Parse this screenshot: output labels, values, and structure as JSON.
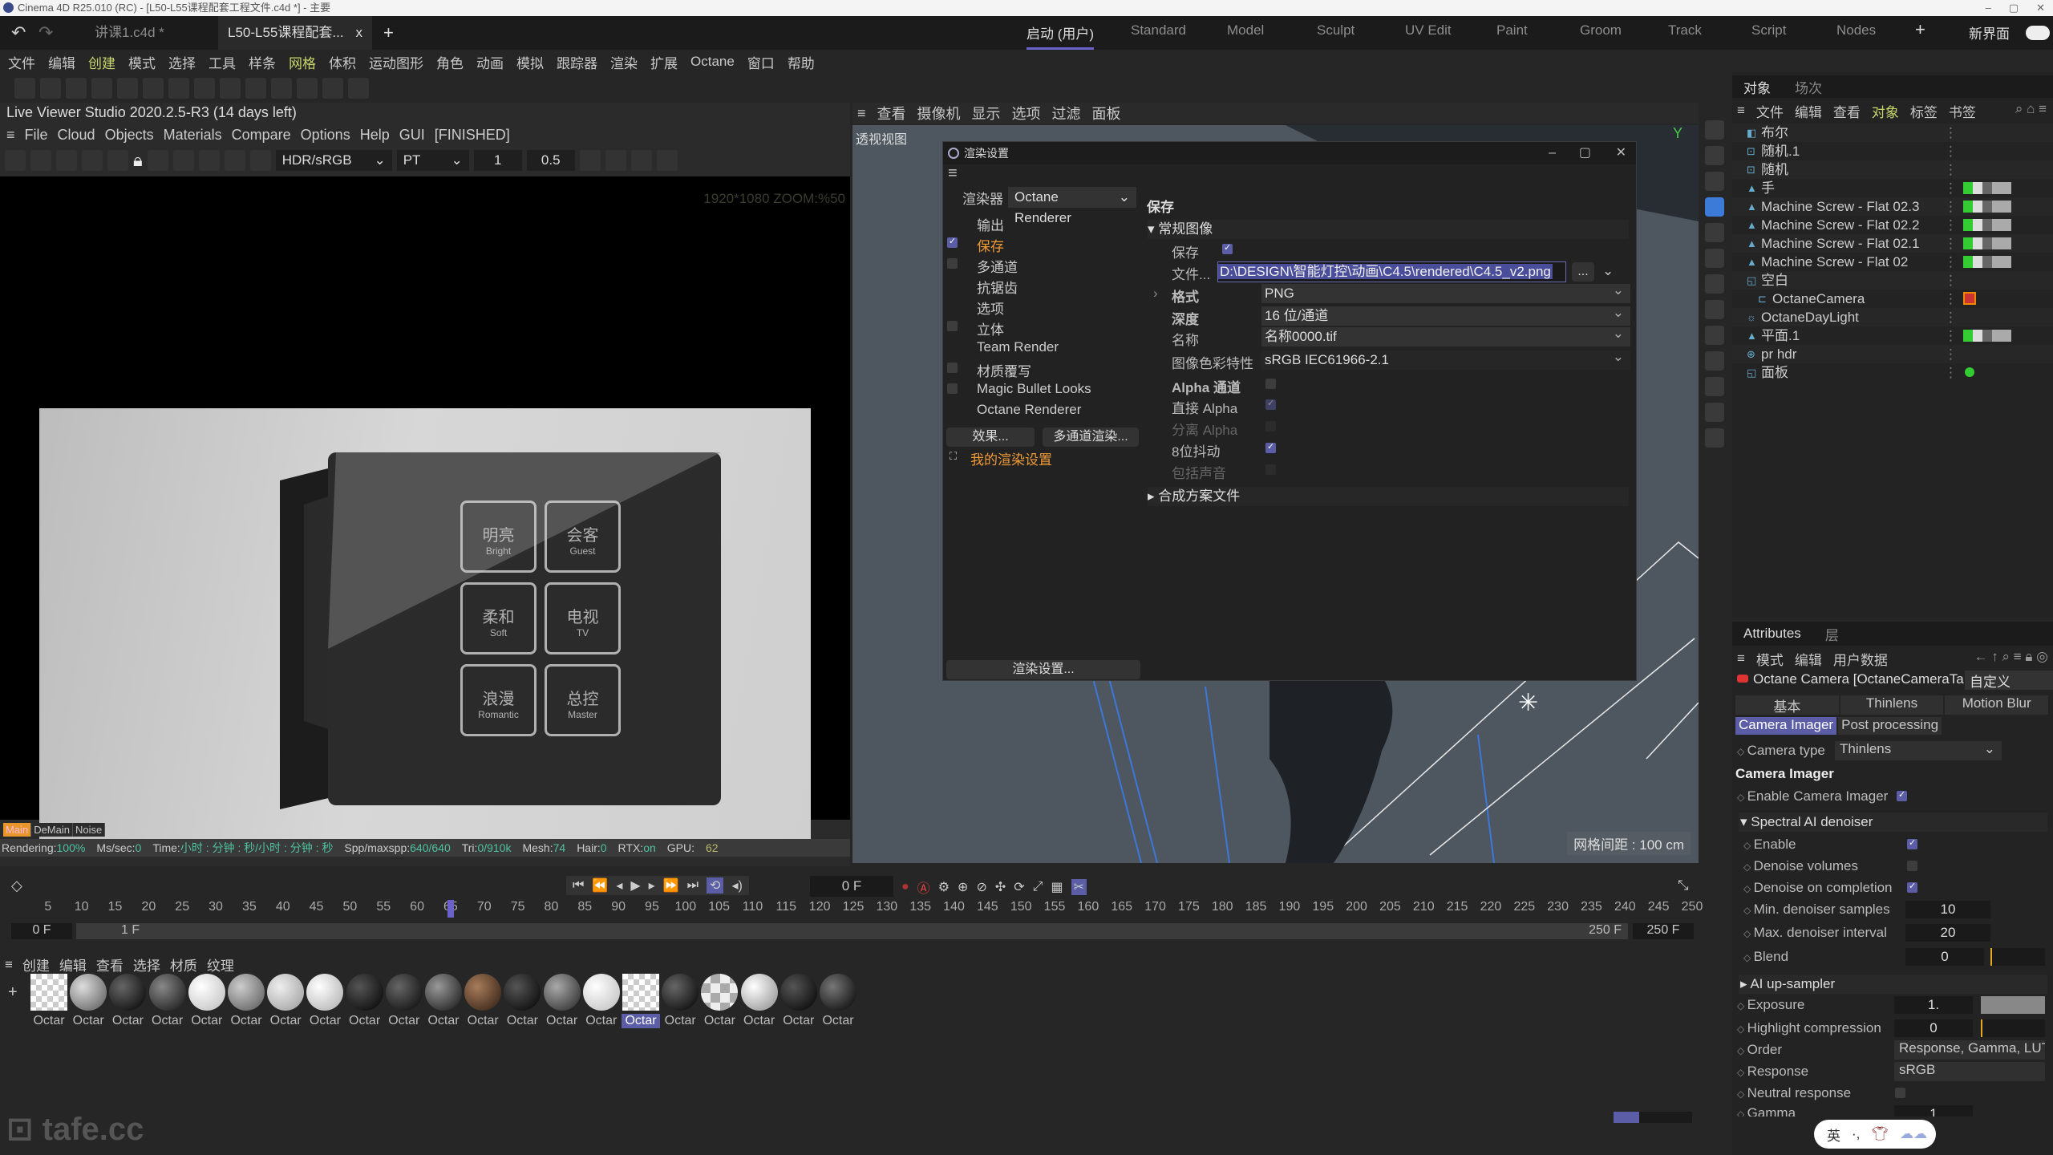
{
  "window": {
    "title": "Cinema 4D R25.010 (RC) - [L50-L55课程配套工程文件.c4d *] - 主要",
    "controls": [
      "–",
      "▢",
      "✕"
    ]
  },
  "file_tabs": [
    {
      "label": "讲课1.c4d *"
    },
    {
      "label": "L50-L55课程配套...",
      "close": "x"
    }
  ],
  "new_tab": "+",
  "layouts": [
    "启动 (用户)",
    "Standard",
    "Model",
    "Sculpt",
    "UV Edit",
    "Paint",
    "Groom",
    "Track",
    "Script",
    "Nodes"
  ],
  "layout_add": "+",
  "new_ui": "新界面",
  "menu": [
    "文件",
    "编辑",
    "创建",
    "模式",
    "选择",
    "工具",
    "样条",
    "网格",
    "体积",
    "运动图形",
    "角色",
    "动画",
    "模拟",
    "跟踪器",
    "渲染",
    "扩展",
    "Octane",
    "窗口",
    "帮助"
  ],
  "live_viewer": {
    "title": "Live Viewer Studio 2020.2.5-R3 (14 days left)",
    "menu": [
      "File",
      "Cloud",
      "Objects",
      "Materials",
      "Compare",
      "Options",
      "Help",
      "GUI",
      "[FINISHED]"
    ],
    "color_mode": "HDR/sRGB",
    "kernel": "PT",
    "value1": "1",
    "value2": "0.5",
    "zoom_label": "1920*1080 ZOOM:%50",
    "render_buttons": [
      {
        "cn": "明亮",
        "en": "Bright"
      },
      {
        "cn": "会客",
        "en": "Guest"
      },
      {
        "cn": "柔和",
        "en": "Soft"
      },
      {
        "cn": "电视",
        "en": "TV"
      },
      {
        "cn": "浪漫",
        "en": "Romantic"
      },
      {
        "cn": "总控",
        "en": "Master"
      }
    ],
    "passes": [
      "Main",
      "DeMain",
      "Noise"
    ],
    "status": {
      "rendering_label": "Rendering:",
      "rendering": "100%",
      "ms_label": "Ms/sec:",
      "ms": "0",
      "time_label": "Time:",
      "time": "小时 : 分钟 : 秒/小时 : 分钟 : 秒",
      "spp_label": "Spp/maxspp:",
      "spp": "640/640",
      "tri_label": "Tri:",
      "tri": "0/910k",
      "mesh_label": "Mesh:",
      "mesh": "74",
      "hair_label": "Hair:",
      "hair": "0",
      "rtx_label": "RTX:",
      "rtx": "on",
      "gpu_label": "GPU:",
      "gpu": "62"
    }
  },
  "viewport": {
    "menu": [
      "查看",
      "摄像机",
      "显示",
      "选项",
      "过滤",
      "面板"
    ],
    "label": "透视视图",
    "grid": "网格间距 : 100 cm"
  },
  "render_settings": {
    "title": "渲染设置",
    "renderer_label": "渲染器",
    "renderer": "Octane Renderer",
    "items": [
      {
        "label": "输出",
        "check": null
      },
      {
        "label": "保存",
        "check": true,
        "selected": true
      },
      {
        "label": "多通道",
        "check": false
      },
      {
        "label": "抗锯齿",
        "check": null
      },
      {
        "label": "选项",
        "check": null
      },
      {
        "label": "立体",
        "check": false
      },
      {
        "label": "Team Render",
        "check": null
      },
      {
        "label": "材质覆写",
        "check": false
      },
      {
        "label": "Magic Bullet Looks",
        "check": false
      },
      {
        "label": "Octane Renderer",
        "check": null
      }
    ],
    "effects_button": "效果...",
    "multipass_button": "多通道渲染...",
    "preset": "我的渲染设置",
    "settings_button": "渲染设置...",
    "heading": "保存",
    "section_regular": "常规图像",
    "section_compose": "合成方案文件",
    "save_label": "保存",
    "save": true,
    "file_label": "文件...",
    "file": "D:\\DESIGN\\智能灯控\\动画\\C4.5\\rendered\\C4.5_v2.png",
    "browse": "...",
    "format_label": "格式",
    "format": "PNG",
    "depth_label": "深度",
    "depth": "16 位/通道",
    "name_label": "名称",
    "name": "名称0000.tif",
    "profile_label": "图像色彩特性",
    "profile": "sRGB IEC61966-2.1",
    "alpha_label": "Alpha 通道",
    "alpha": false,
    "straight_label": "直接 Alpha",
    "straight": true,
    "separate_label": "分离 Alpha",
    "separate": false,
    "dither_label": "8位抖动",
    "dither": true,
    "sound_label": "包括声音",
    "sound": false
  },
  "object_manager": {
    "tabs": [
      "对象",
      "场次"
    ],
    "menu": [
      "文件",
      "编辑",
      "查看",
      "对象",
      "标签",
      "书签"
    ],
    "objects": [
      {
        "name": "布尔",
        "indent": 0
      },
      {
        "name": "随机.1",
        "indent": 0
      },
      {
        "name": "随机",
        "indent": 0
      },
      {
        "name": "手",
        "indent": 0
      },
      {
        "name": "Machine Screw - Flat 02.3",
        "indent": 0
      },
      {
        "name": "Machine Screw - Flat 02.2",
        "indent": 0
      },
      {
        "name": "Machine Screw - Flat 02.1",
        "indent": 0
      },
      {
        "name": "Machine Screw - Flat 02",
        "indent": 0
      },
      {
        "name": "空白",
        "indent": 0
      },
      {
        "name": "OctaneCamera",
        "indent": 1
      },
      {
        "name": "OctaneDayLight",
        "indent": 0
      },
      {
        "name": "平面.1",
        "indent": 0
      },
      {
        "name": "pr hdr",
        "indent": 0
      },
      {
        "name": "面板",
        "indent": 0
      }
    ]
  },
  "attributes": {
    "tabs": [
      "Attributes",
      "层"
    ],
    "menu": [
      "模式",
      "编辑",
      "用户数据"
    ],
    "object": "Octane Camera [OctaneCameraTa",
    "preset": "自定义",
    "tabs_row1": [
      "基本",
      "Thinlens",
      "Motion Blur"
    ],
    "tabs_row2": [
      "Camera Imager",
      "Post processing"
    ],
    "camera_type_label": "Camera type",
    "camera_type": "Thinlens",
    "heading": "Camera Imager",
    "enable_ci_label": "Enable Camera Imager",
    "enable_ci": true,
    "denoiser_section": "Spectral AI denoiser",
    "enable_label": "Enable",
    "enable": true,
    "vol_label": "Denoise volumes",
    "vol": false,
    "completion_label": "Denoise on completion",
    "completion": true,
    "min_label": "Min. denoiser samples",
    "min": "10",
    "max_label": "Max. denoiser interval",
    "max": "20",
    "blend_label": "Blend",
    "blend": "0",
    "upsampler_section": "AI up-sampler",
    "exposure_label": "Exposure",
    "exposure": "1.",
    "highlight_label": "Highlight compression",
    "highlight": "0",
    "order_label": "Order",
    "order": "Response, Gamma, LUT",
    "response_label": "Response",
    "response": "sRGB",
    "neutral_label": "Neutral response",
    "neutral": false,
    "gamma_label": "Gamma",
    "gamma": "1"
  },
  "timeline": {
    "current_frame": "0 F",
    "ruler_start": 0,
    "ruler_end": 250,
    "ruler_step": 5,
    "playhead": 65,
    "range_start": "0 F",
    "range_in": "1 F",
    "range_out": "250 F",
    "range_end": "250 F"
  },
  "materials": {
    "menu": [
      "创建",
      "编辑",
      "查看",
      "选择",
      "材质",
      "纹理"
    ],
    "label": "Octar",
    "count": 21,
    "selected_index": 15
  },
  "branding": {
    "logo": "tafe.cc"
  },
  "ime": {
    "label": "英",
    "punct": "·,"
  },
  "colors": {
    "accent": "#5b5ea6",
    "highlight_menu": "#c8d66b",
    "selected_item": "#f09a35",
    "status_value": "#4ec2a0"
  }
}
